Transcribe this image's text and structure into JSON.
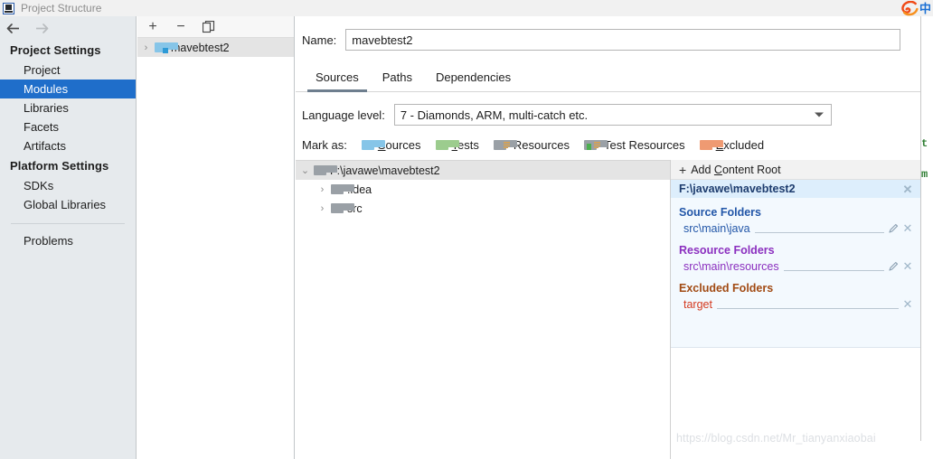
{
  "window": {
    "title": "Project Structure",
    "title_icon": "intellij-idea-icon"
  },
  "tray": {
    "sogou_logo": "sogou-pinyin-icon",
    "ime_mode": "中"
  },
  "nav": {
    "back_icon": "arrow-left-icon",
    "forward_icon": "arrow-right-icon",
    "sections": [
      {
        "heading": "Project Settings",
        "items": [
          {
            "label": "Project",
            "selected": false
          },
          {
            "label": "Modules",
            "selected": true
          },
          {
            "label": "Libraries",
            "selected": false
          },
          {
            "label": "Facets",
            "selected": false
          },
          {
            "label": "Artifacts",
            "selected": false
          }
        ]
      },
      {
        "heading": "Platform Settings",
        "items": [
          {
            "label": "SDKs",
            "selected": false
          },
          {
            "label": "Global Libraries",
            "selected": false
          }
        ]
      }
    ],
    "problems_label": "Problems"
  },
  "modules_panel": {
    "toolbar": {
      "add_label": "+",
      "remove_label": "−",
      "copy_icon": "copy-icon"
    },
    "items": [
      {
        "label": "mavebtest2",
        "expand_icon": "chevron-right-icon",
        "selected": true
      }
    ]
  },
  "main": {
    "name_label": "Name:",
    "name_value": "mavebtest2",
    "name_placeholder": "",
    "tabs": [
      {
        "label": "Sources",
        "active": true
      },
      {
        "label": "Paths",
        "active": false
      },
      {
        "label": "Dependencies",
        "active": false
      }
    ],
    "language_level_label": "Language level:",
    "language_level_value": "7 - Diamonds, ARM, multi-catch etc.",
    "mark_as": {
      "label": "Mark as:",
      "options": [
        {
          "label": "Sources",
          "mnemonic": "S",
          "icon": "folder-blue-icon"
        },
        {
          "label": "Tests",
          "mnemonic": "T",
          "icon": "folder-green-icon"
        },
        {
          "label": "Resources",
          "mnemonic": "",
          "icon": "folder-resources-icon"
        },
        {
          "label": "Test Resources",
          "mnemonic": "",
          "icon": "folder-test-resources-icon"
        },
        {
          "label": "Excluded",
          "mnemonic": "E",
          "icon": "folder-orange-icon"
        }
      ]
    },
    "tree": {
      "root": {
        "label": "F:\\javawe\\mavebtest2",
        "expand_icon": "chevron-down-icon",
        "icon": "folder-gray-icon"
      },
      "children": [
        {
          "label": ".idea",
          "expand_icon": "chevron-right-icon",
          "icon": "folder-gray-icon"
        },
        {
          "label": "src",
          "expand_icon": "chevron-right-icon",
          "icon": "folder-gray-icon"
        }
      ]
    },
    "content_roots": {
      "add_label": "Add Content Root",
      "add_mnemonic": "C",
      "add_icon": "plus-icon",
      "root_path": "F:\\javawe\\mavebtest2",
      "close_icon": "close-icon",
      "groups": [
        {
          "title": "Source Folders",
          "color": "#2256a8",
          "entries": [
            {
              "path": "src\\main\\java",
              "has_edit": true,
              "edit_icon": "pencil-icon",
              "remove_icon": "close-icon"
            }
          ]
        },
        {
          "title": "Resource Folders",
          "color": "#8b2fbf",
          "entries": [
            {
              "path": "src\\main\\resources",
              "has_edit": true,
              "edit_icon": "pencil-icon",
              "remove_icon": "close-icon"
            }
          ]
        },
        {
          "title": "Excluded Folders",
          "color": "#a14a13",
          "entries": [
            {
              "path": "target",
              "has_edit": false,
              "edit_icon": "",
              "remove_icon": "close-icon"
            }
          ]
        }
      ]
    }
  },
  "watermark": {
    "text": "https://blog.csdn.net/Mr_tianyanxiaobai"
  },
  "background": {
    "code_fragment_1": "t",
    "code_fragment_2": "m"
  }
}
